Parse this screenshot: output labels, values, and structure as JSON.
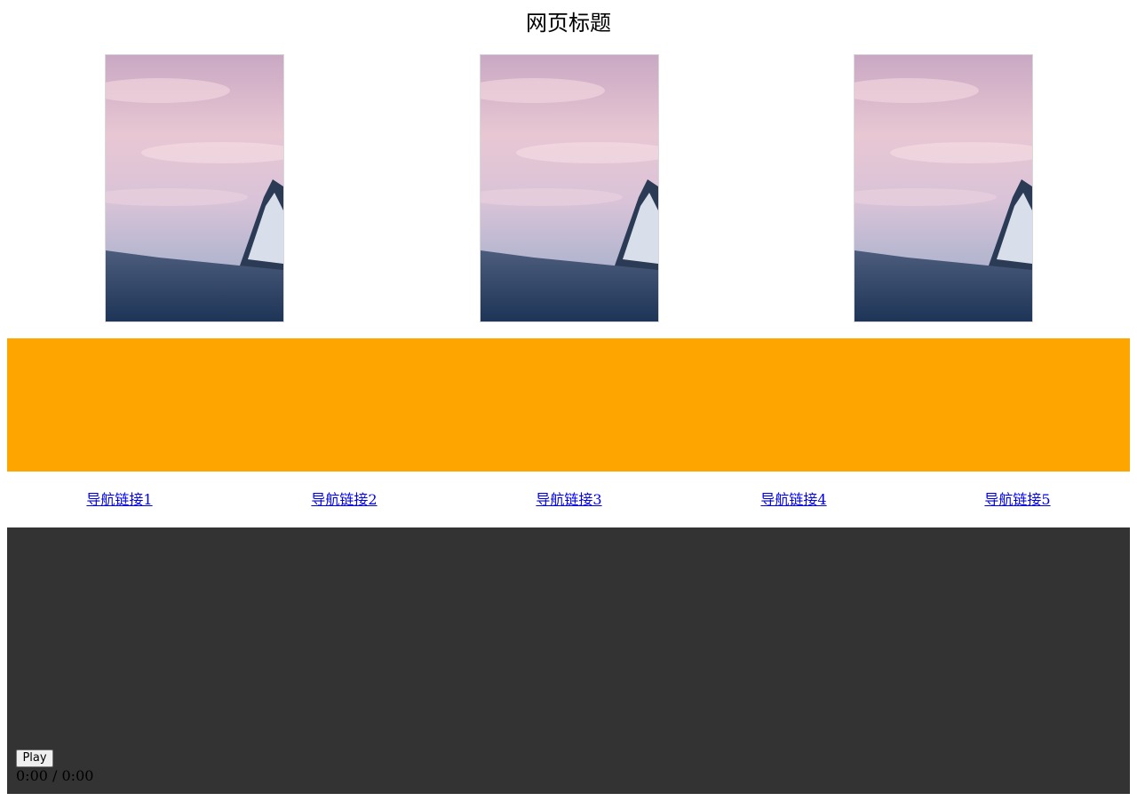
{
  "page": {
    "title": "网页标题"
  },
  "gallery": {
    "images": [
      {
        "name": "mountain-sunset-image-1"
      },
      {
        "name": "mountain-sunset-image-2"
      },
      {
        "name": "mountain-sunset-image-3"
      }
    ]
  },
  "banner": {
    "color": "#ffa500"
  },
  "nav": {
    "links": [
      {
        "label": "导航链接1"
      },
      {
        "label": "导航链接2"
      },
      {
        "label": "导航链接3"
      },
      {
        "label": "导航链接4"
      },
      {
        "label": "导航链接5"
      }
    ]
  },
  "video": {
    "background": "#333333",
    "play_label": "Play",
    "time": "0:00 / 0:00"
  }
}
